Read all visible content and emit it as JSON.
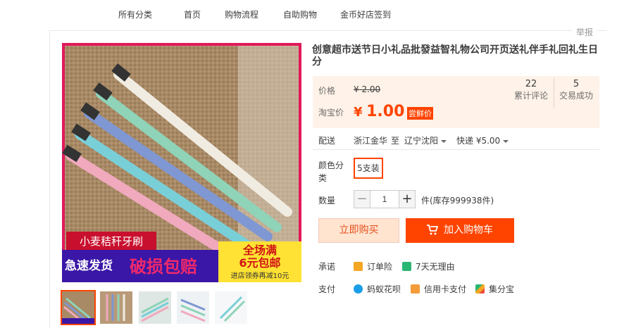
{
  "topnav": {
    "items": [
      "所有分类",
      "首页",
      "购物流程",
      "自助购物",
      "金币好店签到"
    ]
  },
  "report_label": "举报",
  "product": {
    "title": "创意超市送节日小礼品批發益智礼物公司开页送礼伴手礼回礼生日分",
    "banner_top": "小麦秸秆牙刷",
    "banner_left": "急速发货",
    "banner_mid": "破损包赔",
    "banner_right_1": "全场满",
    "banner_right_2": "6元包邮",
    "banner_right_3": "进店领券再减10元"
  },
  "price": {
    "label": "价格",
    "old": "¥ 2.00",
    "taobao_label": "淘宝价",
    "yen": "¥",
    "new": "1.00",
    "tag": "尝鲜价"
  },
  "stats": [
    {
      "value": "22",
      "label": "累计评论"
    },
    {
      "value": "5",
      "label": "交易成功"
    }
  ],
  "shipping": {
    "label": "配送",
    "from": "浙江金华",
    "to_word": "至",
    "to": "辽宁沈阳",
    "method": "快递 ¥5.00"
  },
  "sku": {
    "label_1": "颜色分",
    "label_2": "类",
    "option": "5支装"
  },
  "quantity": {
    "label": "数量",
    "minus": "−",
    "plus": "+",
    "value": "1",
    "unit": "件(库存999938件)"
  },
  "buttons": {
    "buy": "立即购买",
    "cart": "加入购物车"
  },
  "promise": {
    "label": "承诺",
    "items": [
      "订单险",
      "7天无理由"
    ]
  },
  "payment": {
    "label": "支付",
    "items": [
      "蚂蚁花呗",
      "信用卡支付",
      "集分宝"
    ]
  },
  "colors": {
    "accent": "#ff4400",
    "price_bg": "#fff2e8"
  }
}
